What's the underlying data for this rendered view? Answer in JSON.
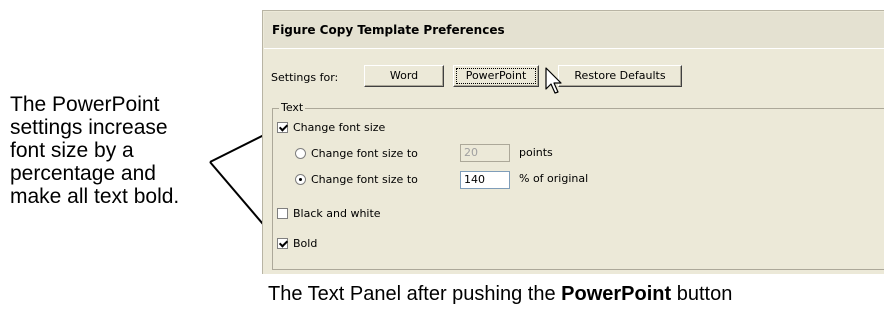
{
  "annotation": {
    "text": "The PowerPoint\nsettings increase\nfont size by a\npercentage and\nmake all text bold."
  },
  "panel": {
    "title": "Figure Copy Template Preferences",
    "settings_for_label": "Settings for:",
    "buttons": {
      "word": "Word",
      "powerpoint": "PowerPoint",
      "restore": "Restore Defaults"
    },
    "text_group": {
      "legend": "Text",
      "change_font_size": {
        "label": "Change font size",
        "checked": true
      },
      "font_points": {
        "label": "Change font size to",
        "value": "20",
        "unit": "points",
        "selected": false
      },
      "font_percent": {
        "label": "Change font size to",
        "value": "140",
        "unit": "% of original",
        "selected": true
      },
      "black_white": {
        "label": "Black and white",
        "checked": false
      },
      "bold": {
        "label": "Bold",
        "checked": true
      }
    }
  },
  "caption": {
    "prefix": "The Text Panel after pushing the ",
    "bold": "PowerPoint",
    "suffix": " button"
  }
}
